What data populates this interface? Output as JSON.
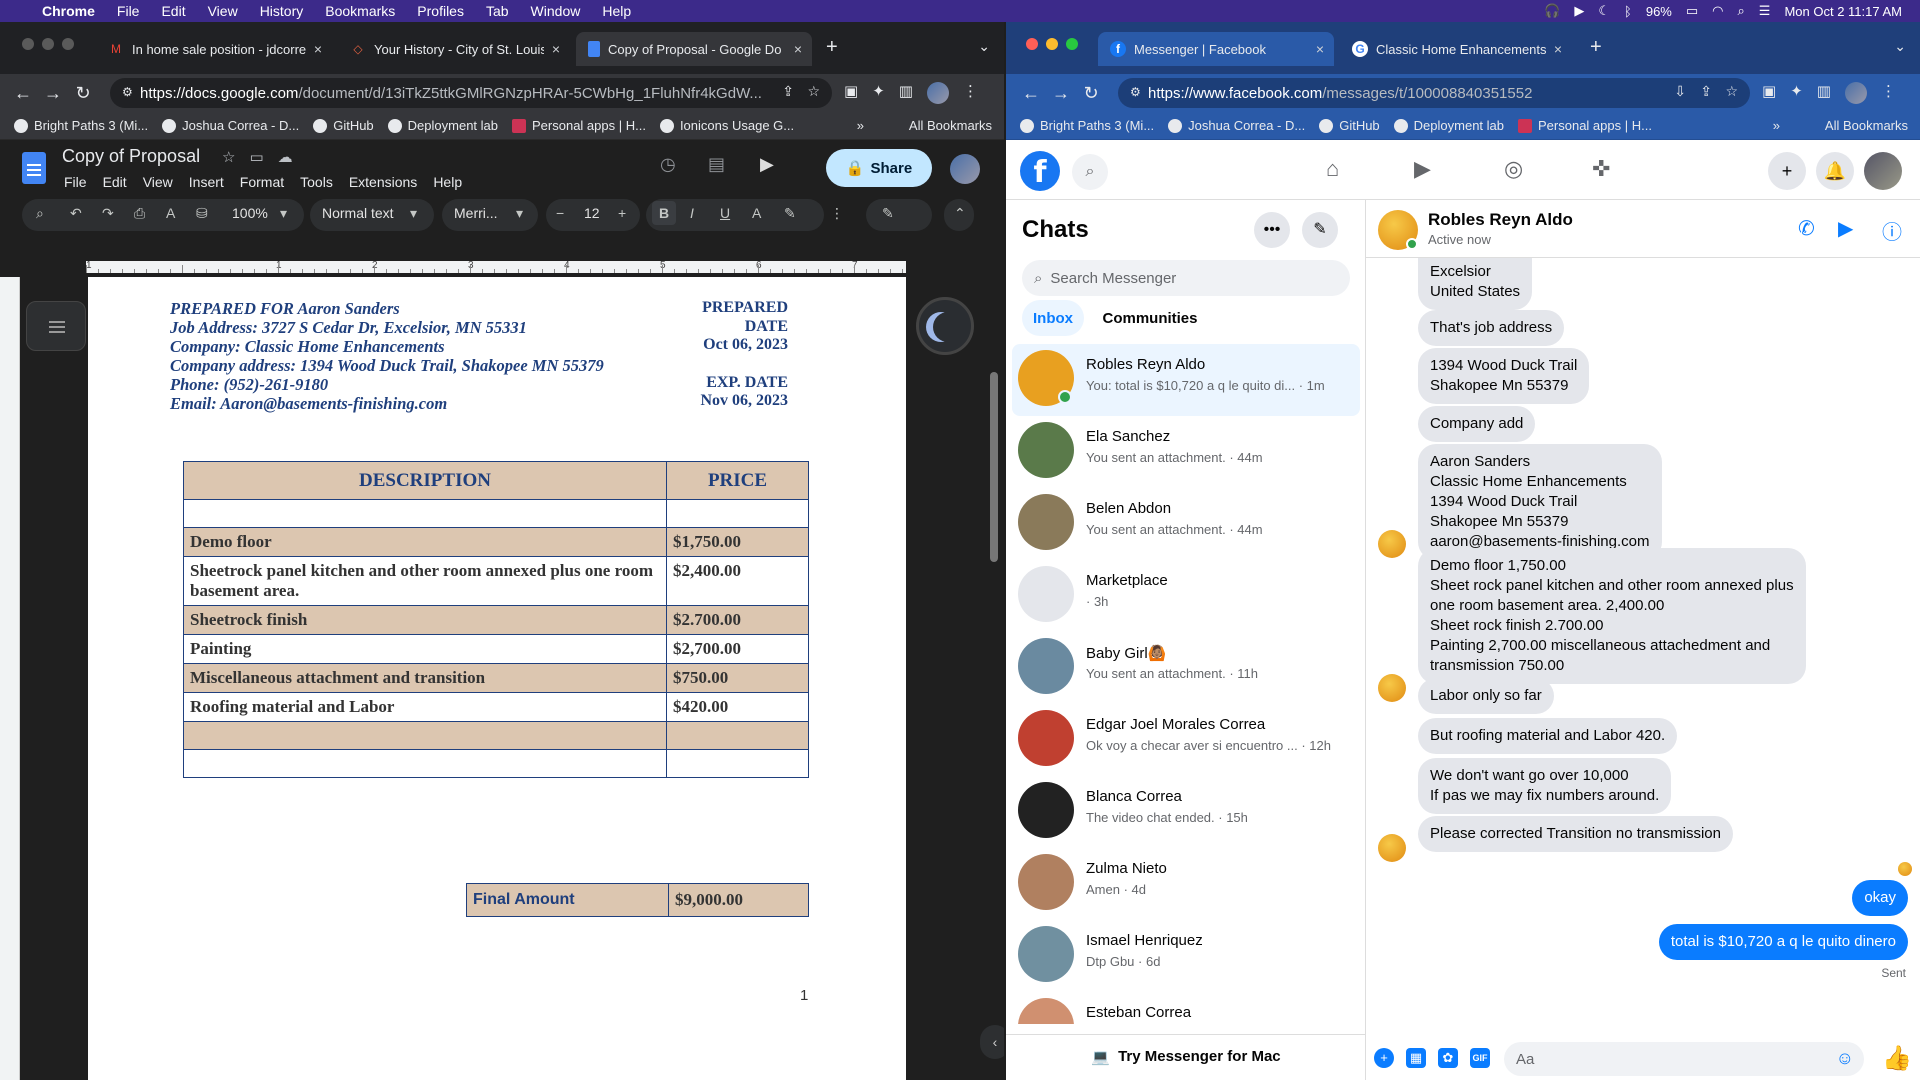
{
  "menubar": {
    "app": "Chrome",
    "items": [
      "File",
      "Edit",
      "View",
      "History",
      "Bookmarks",
      "Profiles",
      "Tab",
      "Window",
      "Help"
    ],
    "battery": "96%",
    "datetime": "Mon Oct 2  11:17 AM"
  },
  "left_window": {
    "tabs": [
      {
        "title": "In home sale position - jdcorre",
        "icon": "gmail-icon"
      },
      {
        "title": "Your History - City of St. Louis",
        "icon": "city-icon"
      },
      {
        "title": "Copy of Proposal - Google Do",
        "icon": "docs-icon"
      }
    ],
    "url_host": "https://docs.google.com",
    "url_rest": "/document/d/13iTkZ5ttkGMlRGNzpHRAr-5CWbHg_1FluhNfr4kGdW...",
    "bookmarks": [
      "Bright Paths 3 (Mi...",
      "Joshua Correa - D...",
      "GitHub",
      "Deployment lab",
      "Personal apps | H...",
      "Ionicons Usage G..."
    ],
    "bookmarks_more": "»",
    "all_bookmarks": "All Bookmarks"
  },
  "docs": {
    "title": "Copy of Proposal",
    "menus": [
      "File",
      "Edit",
      "View",
      "Insert",
      "Format",
      "Tools",
      "Extensions",
      "Help"
    ],
    "share": "Share",
    "zoom": "100%",
    "style": "Normal text",
    "font": "Merri...",
    "font_size": "12",
    "ruler_numbers": [
      "1",
      "1",
      "2",
      "3",
      "4",
      "5",
      "6",
      "7"
    ],
    "prepared_for": "PREPARED FOR Aaron Sanders",
    "job_address": "Job Address: 3727 S Cedar Dr, Excelsior, MN 55331",
    "company": "Company: Classic Home Enhancements",
    "company_address": "Company address: 1394 Wood Duck Trail, Shakopee MN 55379",
    "phone": "Phone: (952)-261-9180",
    "email": "Email: Aaron@basements-finishing.com",
    "prepared_label_1": "PREPARED",
    "prepared_label_2": "DATE",
    "prepared_date": "Oct 06, 2023",
    "exp_label": "EXP. DATE",
    "exp_date": "Nov 06, 2023",
    "table_headers": {
      "description": "DESCRIPTION",
      "price": "PRICE"
    },
    "rows": [
      {
        "desc": "",
        "price": "",
        "shade": false
      },
      {
        "desc": "Demo floor",
        "price": "$1,750.00",
        "shade": true
      },
      {
        "desc": "Sheetrock panel kitchen and other room annexed plus one room basement area.",
        "price": "$2,400.00",
        "shade": false
      },
      {
        "desc": "Sheetrock finish",
        "price": "$2.700.00",
        "shade": true
      },
      {
        "desc": "Painting",
        "price": "$2,700.00",
        "shade": false
      },
      {
        "desc": "Miscellaneous attachment and transition",
        "price": "$750.00",
        "shade": true
      },
      {
        "desc": "Roofing material and Labor",
        "price": "$420.00",
        "shade": false
      },
      {
        "desc": "",
        "price": "",
        "shade": true
      },
      {
        "desc": "",
        "price": "",
        "shade": false
      }
    ],
    "final_label": "Final Amount",
    "final_value": "$9,000.00",
    "page_number": "1"
  },
  "right_window": {
    "tabs": [
      {
        "title": "Messenger | Facebook",
        "icon": "facebook-icon"
      },
      {
        "title": "Classic Home Enhancements",
        "icon": "google-icon"
      }
    ],
    "url_host": "https://www.facebook.com",
    "url_rest": "/messages/t/100008840351552",
    "bookmarks": [
      "Bright Paths 3 (Mi...",
      "Joshua Correa - D...",
      "GitHub",
      "Deployment lab",
      "Personal apps | H..."
    ],
    "bookmarks_more": "»",
    "all_bookmarks": "All Bookmarks"
  },
  "messenger": {
    "chats_title": "Chats",
    "search_placeholder": "Search Messenger",
    "tab_inbox": "Inbox",
    "tab_communities": "Communities",
    "conversations": [
      {
        "name": "Robles Reyn Aldo",
        "preview": "You: total is $10,720 a q le quito di... · 1m",
        "color": "#e8a020",
        "selected": true
      },
      {
        "name": "Ela Sanchez",
        "preview": "You sent an attachment. · 44m",
        "color": "#5a7a4a"
      },
      {
        "name": "Belen Abdon",
        "preview": "You sent an attachment. · 44m",
        "color": "#8a7a5a"
      },
      {
        "name": "Marketplace",
        "preview": "· 3h",
        "color": "#e4e6eb"
      },
      {
        "name": "Baby Girl🙆🏽",
        "preview": "You sent an attachment. · 11h",
        "color": "#6a8aa0"
      },
      {
        "name": "Edgar Joel Morales Correa",
        "preview": "Ok voy a checar aver si encuentro ... · 12h",
        "color": "#c04030"
      },
      {
        "name": "Blanca Correa",
        "preview": "The video chat ended. · 15h",
        "color": "#222222"
      },
      {
        "name": "Zulma Nieto",
        "preview": "Amen · 4d",
        "color": "#b08060"
      },
      {
        "name": "Ismael Henriquez",
        "preview": "Dtp Gbu · 6d",
        "color": "#7090a0"
      },
      {
        "name": "Esteban Correa",
        "preview": "",
        "color": "#d09070"
      }
    ],
    "try_mac": "Try Messenger for Mac",
    "contact_name": "Robles Reyn Aldo",
    "contact_status": "Active now",
    "messages": [
      {
        "text": "Excelsior\nUnited States",
        "me": false
      },
      {
        "text": "That's job address",
        "me": false
      },
      {
        "text": "1394 Wood Duck Trail\nShakopee Mn 55379",
        "me": false
      },
      {
        "text": "Company add",
        "me": false
      },
      {
        "text": "Aaron Sanders\nClassic Home Enhancements\n1394 Wood Duck Trail\nShakopee Mn 55379\naaron@basements-finishing.com",
        "me": false
      },
      {
        "text": "Demo floor 1,750.00\nSheet rock panel kitchen and  other room annexed plus\none room basement area. 2,400.00\nSheet rock finish 2.700.00\nPainting 2,700.00 miscellaneous attachedment and\ntransmission 750.00",
        "me": false
      },
      {
        "text": "Labor only so far",
        "me": false
      },
      {
        "text": "But roofing material and Labor 420.",
        "me": false
      },
      {
        "text": "We don't want go over 10,000\nIf pas we may fix numbers around.",
        "me": false
      },
      {
        "text": "Please corrected Transition no transmission",
        "me": false
      },
      {
        "text": "okay",
        "me": true
      },
      {
        "text": "total is $10,720 a q le quito dinero",
        "me": true
      }
    ],
    "sent_label": "Sent",
    "composer_placeholder": "Aa"
  }
}
